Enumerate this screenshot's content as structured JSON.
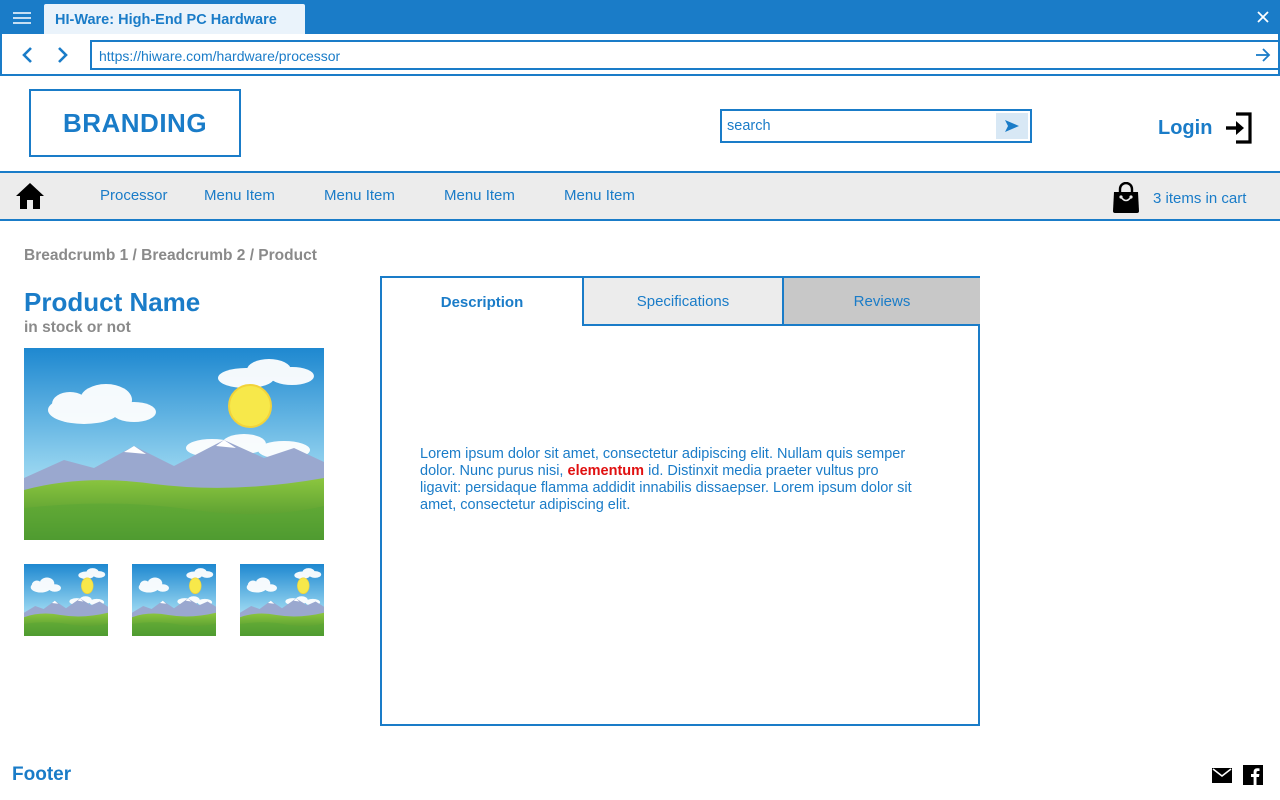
{
  "browser": {
    "tab_title": "HI-Ware: High-End PC Hardware",
    "url": "https://hiware.com/hardware/processor"
  },
  "header": {
    "brand": "BRANDING",
    "search_placeholder": "search",
    "login_label": "Login"
  },
  "menu": {
    "items": [
      "Processor",
      "Menu Item",
      "Menu Item",
      "Menu Item",
      "Menu Item"
    ],
    "cart_label": "3 items in cart"
  },
  "breadcrumb": "Breadcrumb 1 / Breadcrumb 2 / Product",
  "product": {
    "name": "Product Name",
    "stock": "in stock or not"
  },
  "tabs": {
    "items": [
      "Description",
      "Specifications",
      "Reviews"
    ],
    "active": "Description"
  },
  "description": {
    "before": "Lorem ipsum dolor sit amet, consectetur adipiscing elit. Nullam quis semper dolor. Nunc purus nisi, ",
    "highlight": "elementum",
    "after": " id. Distinxit  media praeter vultus pro ligavit: persidaque flamma addidit innabilis dissaepser. Lorem ipsum dolor sit amet, consectetur adipiscing elit."
  },
  "footer": {
    "label": "Footer"
  },
  "icons": {
    "menu": "hamburger-menu-icon",
    "close": "close-icon",
    "back": "chevron-left-icon",
    "forward": "chevron-right-icon",
    "go": "arrow-right-icon",
    "search": "send-icon",
    "login": "login-icon",
    "home": "home-icon",
    "cart": "shopping-bag-icon",
    "mail": "mail-icon",
    "facebook": "facebook-icon"
  },
  "colors": {
    "accent": "#1a7cc8",
    "muted_text": "#8a8a8a",
    "highlight": "#e01010",
    "menu_bg": "#ececec"
  }
}
